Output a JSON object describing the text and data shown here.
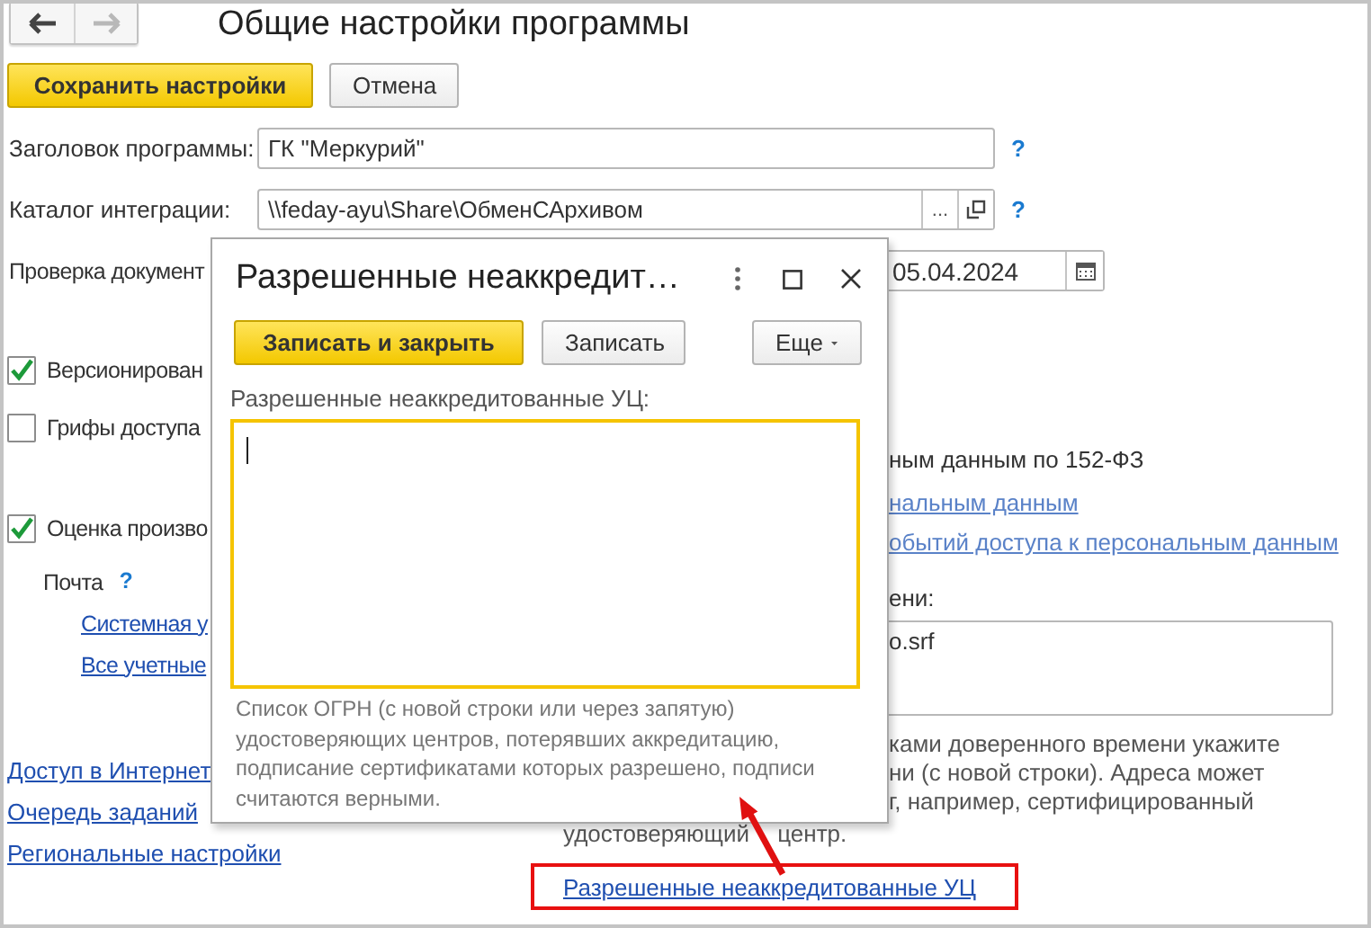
{
  "window": {
    "title": "Общие настройки программы"
  },
  "nav": [
    {
      "kind": "back",
      "disabled": false
    },
    {
      "kind": "forward",
      "disabled": true
    }
  ],
  "toolbar": [
    {
      "label": "Сохранить настройки",
      "primary": true
    },
    {
      "label": "Отмена",
      "primary": false
    }
  ],
  "fields": [
    {
      "kind": "text",
      "label": "Заголовок программы:",
      "value": "ГК \"Меркурий\"",
      "help": "?"
    },
    {
      "kind": "path",
      "label": "Каталог интеграции:",
      "value": "\\\\feday-ayu\\Share\\ОбменСАрхивом",
      "select_button": "...",
      "help": "?"
    },
    {
      "kind": "date",
      "label": "Проверка документ",
      "value": "05.04.2024"
    }
  ],
  "left_options": [
    {
      "kind": "checkbox",
      "label": "Версионирован",
      "checked": true
    },
    {
      "kind": "checkbox",
      "label": "Грифы доступа",
      "checked": false
    },
    {
      "kind": "checkbox",
      "label": "Оценка произво",
      "checked": true
    },
    {
      "kind": "heading",
      "label": "Почта",
      "help": "?"
    },
    {
      "kind": "link",
      "label": "Системная у"
    },
    {
      "kind": "link",
      "label": "Все учетные"
    }
  ],
  "left_links": [
    "Доступ в Интернет",
    "Очередь заданий",
    "Региональные настройки"
  ],
  "right_items": [
    {
      "kind": "text",
      "text": "ным данным по 152-ФЗ"
    },
    {
      "kind": "link",
      "text": "нальным данным"
    },
    {
      "kind": "link",
      "text": "обытий доступа к персональным данным"
    },
    {
      "kind": "text",
      "text": "ени:"
    },
    {
      "kind": "field",
      "text": "o.srf"
    },
    {
      "kind": "note",
      "text": "ками доверенного времени укажите"
    },
    {
      "kind": "note",
      "text": "ни (с новой строки). Адреса может"
    },
    {
      "kind": "note",
      "text": "г, например, сертифицированный"
    }
  ],
  "footer_note": "удостоверяющий центр.",
  "highlighted_link": "Разрешенные неаккредитованные УЦ",
  "dialog": {
    "title": "Разрешенные неаккредит…",
    "buttons": [
      {
        "label": "Записать и закрыть",
        "primary": true,
        "dropdown": false
      },
      {
        "label": "Записать",
        "primary": false,
        "dropdown": false
      },
      {
        "label": "Еще",
        "primary": false,
        "dropdown": true
      }
    ],
    "field_label": "Разрешенные неаккредитованные УЦ:",
    "hint": "Список ОГРН (с новой строки или через запятую) удостоверяющих центров, потерявших аккредитацию, подписание сертификатами которых разрешено, подписи считаются верными."
  }
}
